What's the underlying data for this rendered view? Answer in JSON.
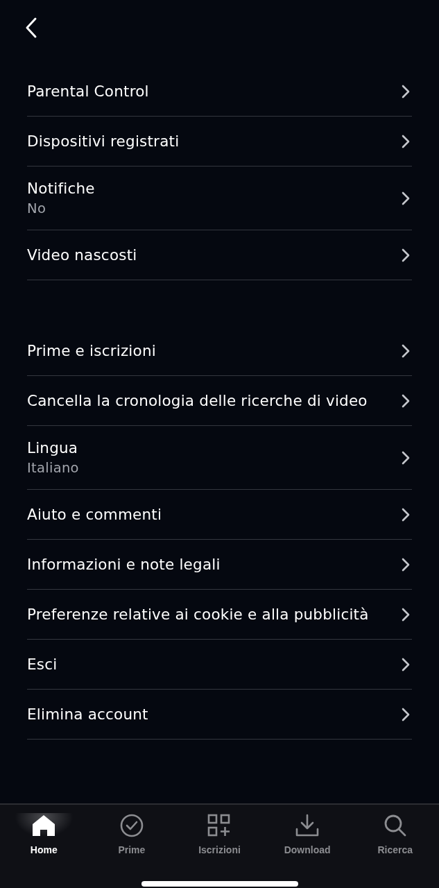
{
  "sections": [
    {
      "items": [
        {
          "label": "Parental Control"
        },
        {
          "label": "Dispositivi registrati"
        },
        {
          "label": "Notifiche",
          "value": "No"
        },
        {
          "label": "Video nascosti"
        }
      ]
    },
    {
      "items": [
        {
          "label": "Prime e iscrizioni"
        },
        {
          "label": "Cancella la cronologia delle ricerche di video"
        },
        {
          "label": "Lingua",
          "value": "Italiano"
        },
        {
          "label": "Aiuto e commenti"
        },
        {
          "label": "Informazioni e note legali"
        },
        {
          "label": "Preferenze relative ai cookie e alla pubblicità"
        },
        {
          "label": "Esci"
        },
        {
          "label": "Elimina account"
        }
      ]
    }
  ],
  "tab_bar": [
    {
      "kind": "home",
      "label": "Home",
      "selected": true
    },
    {
      "kind": "check",
      "label": "Prime",
      "selected": false
    },
    {
      "kind": "grid",
      "label": "Iscrizioni",
      "selected": false
    },
    {
      "kind": "download",
      "label": "Download",
      "selected": false
    },
    {
      "kind": "search",
      "label": "Ricerca",
      "selected": false
    }
  ]
}
